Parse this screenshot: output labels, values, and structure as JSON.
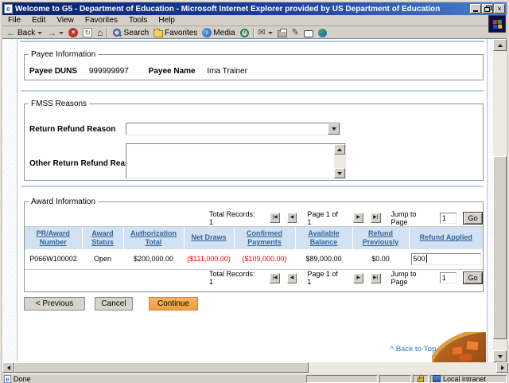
{
  "window": {
    "title": "Welcome to G5 - Department of Education - Microsoft Internet Explorer provided by US Department of Education"
  },
  "menu": {
    "items": [
      "File",
      "Edit",
      "View",
      "Favorites",
      "Tools",
      "Help"
    ]
  },
  "toolbar": {
    "back": "Back",
    "search": "Search",
    "favorites": "Favorites",
    "media": "Media"
  },
  "page": {
    "payee": {
      "legend": "Payee Information",
      "duns_label": "Payee DUNS",
      "duns_value": "999999997",
      "name_label": "Payee Name",
      "name_value": "Ima Trainer"
    },
    "fmss": {
      "legend": "FMSS Reasons",
      "return_reason_label": "Return Refund Reason",
      "return_reason_value": "",
      "other_reason_label": "Other Return Refund Reason",
      "other_reason_value": ""
    },
    "award": {
      "legend": "Award Information",
      "pagination": {
        "total_records": "Total Records: 1",
        "first_glyph": "|◀",
        "prev_glyph": "◀",
        "page_label": "Page 1 of 1",
        "next_glyph": "▶",
        "last_glyph": "▶|",
        "jump_label": "Jump to Page",
        "jump_value": "1",
        "go_label": "Go"
      },
      "columns": [
        "PR/Award Number",
        "Award Status",
        "Authorization Total",
        "Net Draws",
        "Confirmed Payments",
        "Available Balance",
        "Refund Previously",
        "Refund Applied"
      ],
      "row": {
        "pr_award_number": "P066W100002",
        "award_status": "Open",
        "authorization_total": "$200,000.00",
        "net_draws": "($111,000.00)",
        "confirmed_payments": "($109,000.00)",
        "available_balance": "$89,000.00",
        "refund_previously": "$0.00",
        "refund_applied": "500"
      }
    },
    "actions": {
      "previous_label": "< Previous",
      "cancel_label": "Cancel",
      "continue_label": "Continue"
    },
    "back_to_top": "^ Back to Top"
  },
  "statusbar": {
    "status": "Done",
    "zone": "Local intranet"
  },
  "colors": {
    "titlebar_left": "#0A246A",
    "titlebar_right": "#4A80C8",
    "table_header_bg": "#D2E2F2",
    "link_blue": "#336699",
    "negative_red": "#FF0000",
    "continue_orange": "#F2A74E",
    "separator_blue": "#B9D0EA",
    "back_to_top_blue": "#6699CC"
  }
}
